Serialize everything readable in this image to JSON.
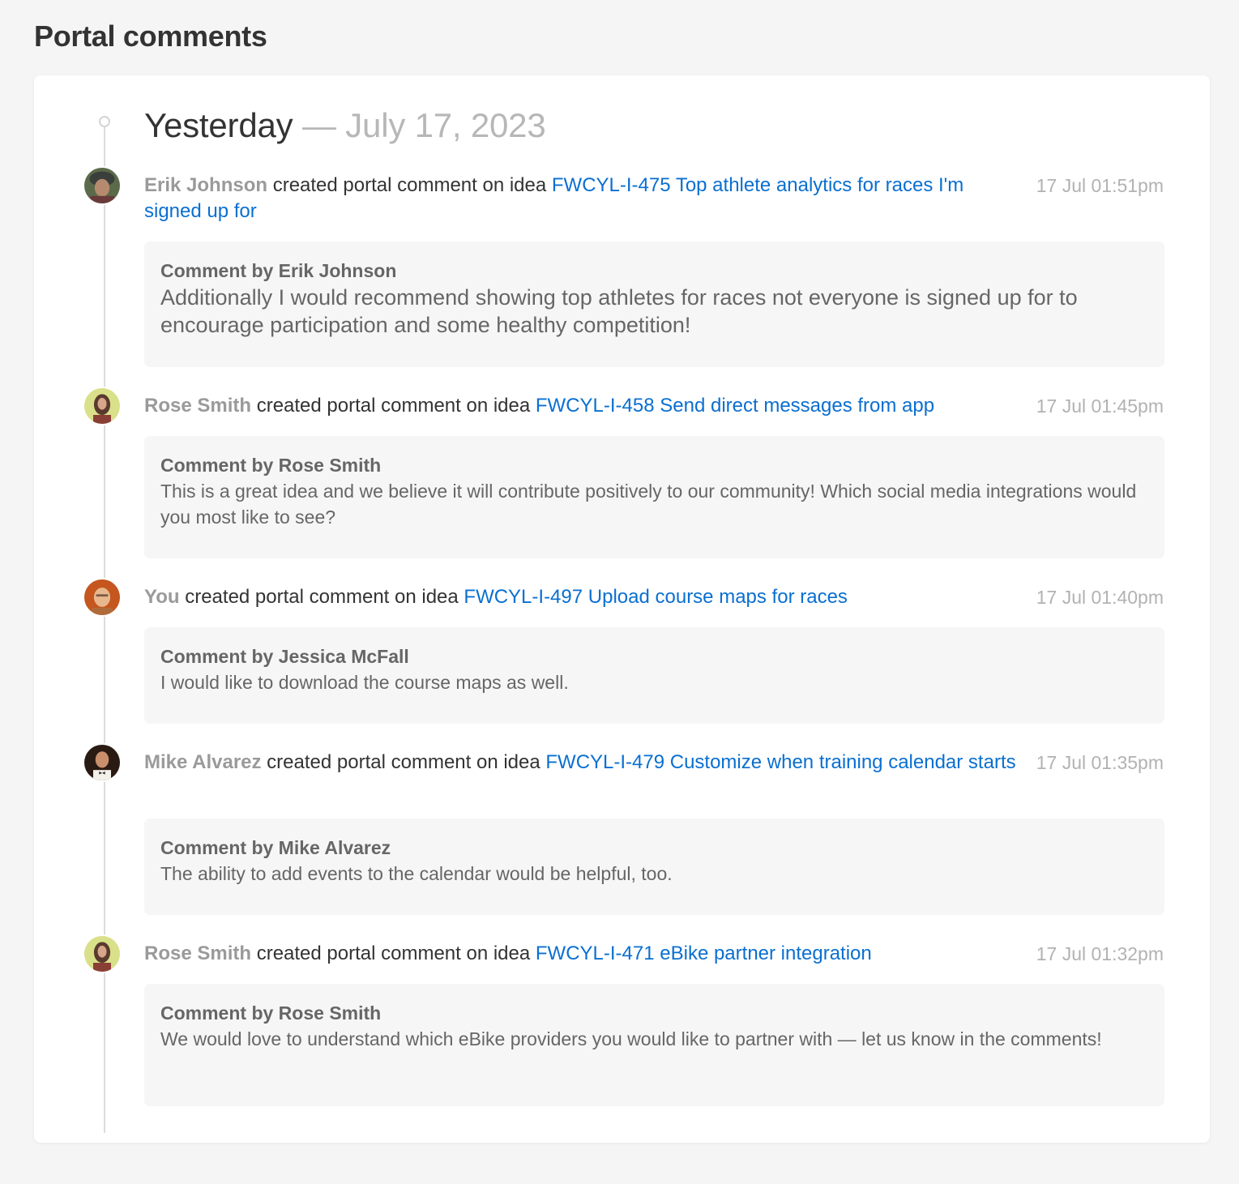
{
  "page": {
    "title": "Portal comments"
  },
  "timeline": {
    "day_label": "Yesterday",
    "separator": "—",
    "date": "July 17, 2023"
  },
  "colors": {
    "link": "#0a6fd1",
    "actor": "#9a9a9a",
    "timestamp": "#b2b2b2",
    "comment_bg": "#f6f6f6"
  },
  "entries": [
    {
      "actor": "Erik Johnson",
      "action": " created portal comment on idea ",
      "idea_link": "FWCYL-I-475 Top athlete analytics for races I'm signed up for",
      "timestamp": "17 Jul 01:51pm",
      "comment_author": "Comment by Erik Johnson",
      "comment_body": "Additionally I would recommend showing top athletes for races not everyone is signed up for to encourage participation and some healthy competition!",
      "avatar_icon": "user-avatar-icon"
    },
    {
      "actor": "Rose Smith",
      "action": " created portal comment on idea ",
      "idea_link": "FWCYL-I-458 Send direct messages from app",
      "timestamp": "17 Jul 01:45pm",
      "comment_author": "Comment by Rose Smith",
      "comment_body": "This is a great idea and we believe it will contribute positively to our community! Which social media integrations would you most like to see?",
      "avatar_icon": "user-avatar-icon"
    },
    {
      "actor": "You",
      "action": " created portal comment on idea ",
      "idea_link": "FWCYL-I-497 Upload course maps for races",
      "timestamp": "17 Jul 01:40pm",
      "comment_author": "Comment by Jessica McFall",
      "comment_body": "I would like to download the course maps as well.",
      "avatar_icon": "user-avatar-icon"
    },
    {
      "actor": "Mike Alvarez",
      "action": " created portal comment on idea ",
      "idea_link": "FWCYL-I-479 Customize when training calendar starts",
      "timestamp": "17 Jul 01:35pm",
      "comment_author": "Comment by Mike Alvarez",
      "comment_body": "The ability to add events to the calendar would be helpful, too.",
      "avatar_icon": "user-avatar-icon"
    },
    {
      "actor": "Rose Smith",
      "action": " created portal comment on idea ",
      "idea_link": "FWCYL-I-471 eBike partner integration",
      "timestamp": "17 Jul 01:32pm",
      "comment_author": "Comment by Rose Smith",
      "comment_body": "We would love to understand which eBike providers you would like to partner with — let us know in the comments!",
      "avatar_icon": "user-avatar-icon"
    }
  ]
}
